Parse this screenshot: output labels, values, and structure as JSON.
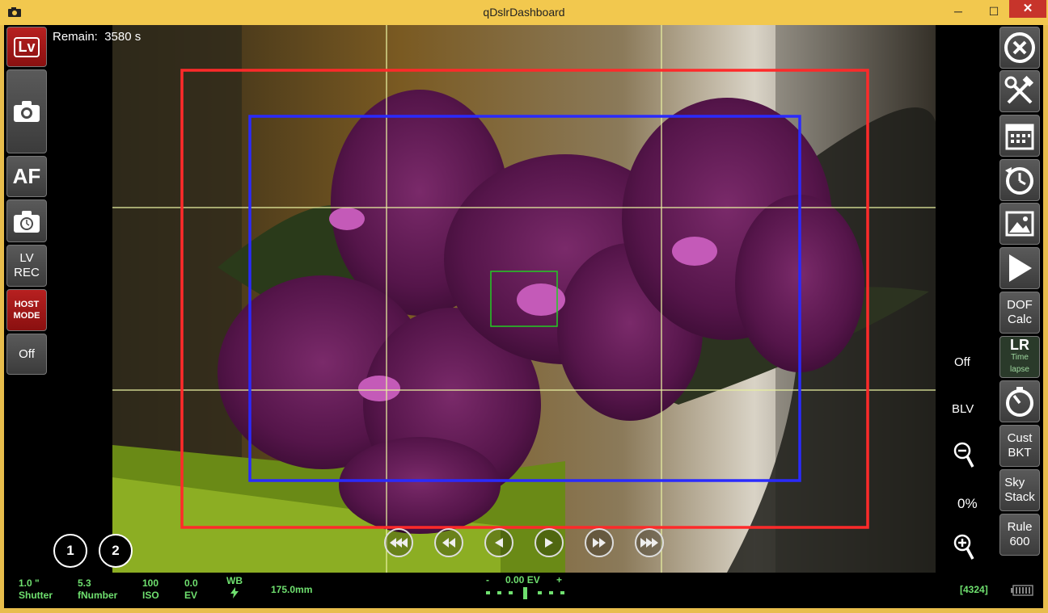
{
  "window": {
    "title": "qDslrDashboard",
    "minimize": "─",
    "maximize": "☐",
    "close": "✕"
  },
  "remain": {
    "label": "Remain:",
    "value": "3580 s"
  },
  "left_toolbar": [
    {
      "id": "lv",
      "label": "Lv"
    },
    {
      "id": "capture",
      "icon": "camera-icon"
    },
    {
      "id": "af",
      "label": "AF"
    },
    {
      "id": "timer-capture",
      "icon": "camera-timer-icon"
    },
    {
      "id": "lv-rec",
      "line1": "LV",
      "line2": "REC"
    },
    {
      "id": "host-mode",
      "line1": "HOST",
      "line2": "MODE"
    },
    {
      "id": "off",
      "label": "Off"
    }
  ],
  "right_toolbar": [
    {
      "id": "close",
      "icon": "close-circle-icon"
    },
    {
      "id": "tools",
      "icon": "tools-icon"
    },
    {
      "id": "calendar",
      "icon": "calendar-icon"
    },
    {
      "id": "history",
      "icon": "clock-icon"
    },
    {
      "id": "gallery",
      "icon": "image-icon"
    },
    {
      "id": "play",
      "icon": "play-icon"
    },
    {
      "id": "dof",
      "line1": "DOF",
      "line2": "Calc"
    },
    {
      "id": "lrtimelapse",
      "label": "LR",
      "sub": "Time lapse"
    },
    {
      "id": "stopwatch",
      "icon": "stopwatch-icon"
    },
    {
      "id": "cust-bkt",
      "line1": "Cust",
      "line2": "BKT"
    },
    {
      "id": "sky-stack",
      "line1": "Sky",
      "line2": "Stack"
    },
    {
      "id": "rule600",
      "line1": "Rule",
      "line2": "600"
    }
  ],
  "side_labels": {
    "off": "Off",
    "blv": "BLV",
    "zoom_percent": "0%"
  },
  "profiles": [
    "1",
    "2"
  ],
  "status": {
    "shutter": {
      "value": "1.0 \"",
      "label": "Shutter"
    },
    "fnumber": {
      "value": "5.3",
      "label": "fNumber"
    },
    "iso": {
      "value": "100",
      "label": "ISO"
    },
    "ev": {
      "value": "0.0",
      "label": "EV"
    },
    "wb": {
      "label": "WB"
    },
    "focal": "175.0mm",
    "exposure": {
      "minus": "-",
      "value": "0.00 EV",
      "plus": "+"
    },
    "shots": "[4324]"
  },
  "colors": {
    "status_green": "#6fe06f",
    "red_button": "#b72020",
    "af_area_outer": "#ff2a2a",
    "af_area_inner": "#2a2aff",
    "focus_box": "#22cc22"
  }
}
